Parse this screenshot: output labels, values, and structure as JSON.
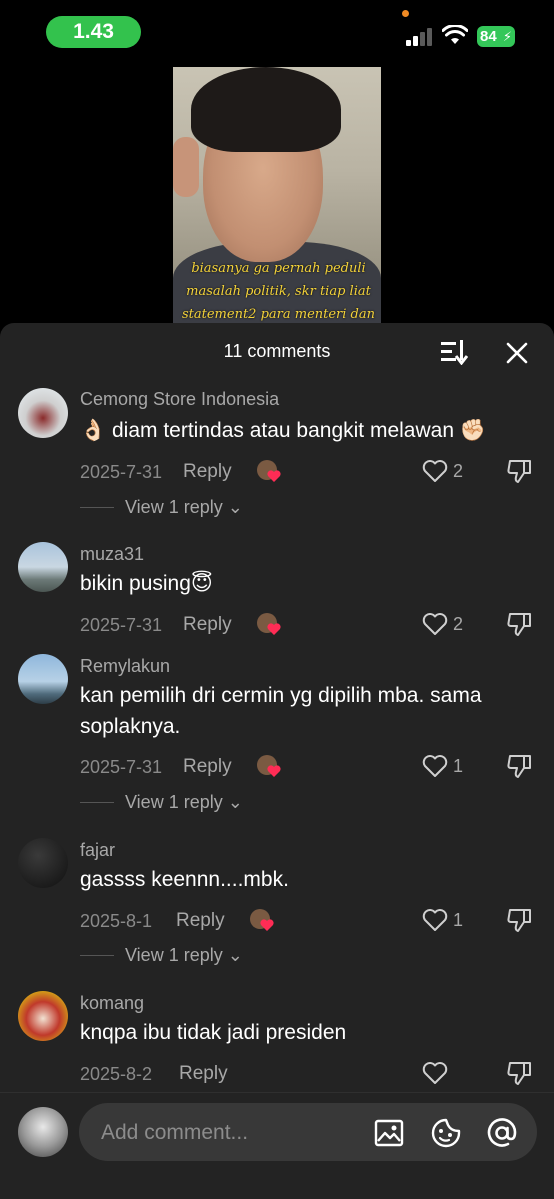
{
  "status_bar": {
    "time": "1.43",
    "battery": "84"
  },
  "video": {
    "caption_lines": [
      "biasanya ga pernah peduli",
      "masalah politik, skr tiap liat",
      "statement2 para menteri dan"
    ]
  },
  "comments_panel": {
    "title": "11 comments",
    "reply_label": "Reply",
    "view_reply_label": "View 1 reply"
  },
  "comments": [
    {
      "username": "Cemong Store Indonesia",
      "text": "👌🏻 diam tertindas atau bangkit melawan ✊🏻",
      "date": "2025-7-31",
      "likes": "2",
      "has_replies": true
    },
    {
      "username": "muza31",
      "text": "bikin pusing😇",
      "date": "2025-7-31",
      "likes": "2",
      "has_replies": false
    },
    {
      "username": "Remylakun",
      "text": "kan pemilih dri cermin yg dipilih mba. sama soplaknya.",
      "date": "2025-7-31",
      "likes": "1",
      "has_replies": true
    },
    {
      "username": "fajar",
      "text": "gassss keennn....mbk.",
      "date": "2025-8-1",
      "likes": "1",
      "has_replies": true
    },
    {
      "username": "komang",
      "text": "knqpa ibu tidak jadi presiden",
      "date": "2025-8-2",
      "likes": "",
      "has_replies": false
    }
  ],
  "input": {
    "placeholder": "Add comment..."
  },
  "icons": {
    "sort": "sort-icon",
    "close": "close-icon",
    "like": "heart-icon",
    "dislike": "thumbs-down-icon",
    "image": "image-icon",
    "sticker": "sticker-icon",
    "mention": "at-icon"
  },
  "colors": {
    "time_pill": "#33c24d",
    "battery": "#34c759",
    "sheet_bg": "#232323",
    "caption": "#f3d23a",
    "reaction_heart": "#ff2c55"
  }
}
